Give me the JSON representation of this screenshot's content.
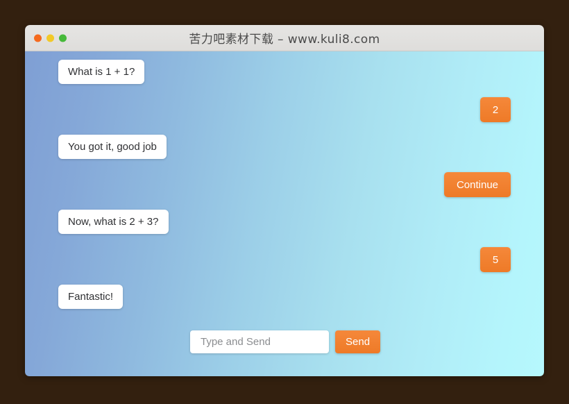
{
  "window": {
    "title": "苦力吧素材下载 – www.kuli8.com",
    "traffic_lights": [
      {
        "name": "close",
        "color": "#f56a1e"
      },
      {
        "name": "minimize",
        "color": "#f2c928"
      },
      {
        "name": "maximize",
        "color": "#46b93a"
      }
    ]
  },
  "theme": {
    "accent": "#ee7a27",
    "bubble_bg": "#ffffff",
    "bubble_text": "#2f3033",
    "chat_gradient_start": "#7f9fd4",
    "chat_gradient_end": "#b6f8fd",
    "titlebar_bg": "#e0dfdd",
    "desktop_bg": "#33200f"
  },
  "chat": {
    "messages": [
      {
        "id": "m1",
        "role": "bot",
        "text": "What is 1 + 1?"
      },
      {
        "id": "m2",
        "role": "user",
        "text": "2"
      },
      {
        "id": "m3",
        "role": "bot",
        "text": "You got it, good job"
      },
      {
        "id": "m4",
        "role": "user",
        "text": "Continue"
      },
      {
        "id": "m5",
        "role": "bot",
        "text": "Now, what is 2 + 3?"
      },
      {
        "id": "m6",
        "role": "user",
        "text": "5"
      },
      {
        "id": "m7",
        "role": "bot",
        "text": "Fantastic!"
      }
    ]
  },
  "composer": {
    "placeholder": "Type and Send",
    "value": "",
    "send_label": "Send"
  }
}
